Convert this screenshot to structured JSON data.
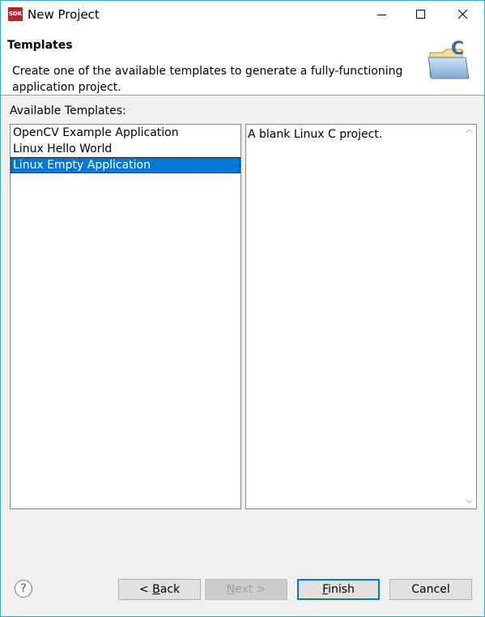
{
  "window": {
    "title": "New Project",
    "app_icon_text": "SDK"
  },
  "header": {
    "title": "Templates",
    "description": "Create one of the available templates to generate a fully-functioning application project."
  },
  "templates": {
    "label": "Available Templates:",
    "items": [
      {
        "label": "OpenCV Example Application",
        "selected": false
      },
      {
        "label": "Linux Hello World",
        "selected": false
      },
      {
        "label": "Linux Empty Application",
        "selected": true
      }
    ],
    "description": "A blank Linux C project."
  },
  "footer": {
    "help_glyph": "?",
    "back": {
      "mnemonic": "B",
      "prefix": "< ",
      "rest": "ack"
    },
    "next": {
      "mnemonic": "N",
      "rest": "ext >"
    },
    "finish": {
      "mnemonic": "F",
      "rest": "inish"
    },
    "cancel": "Cancel"
  },
  "colors": {
    "selection": "#0078d7",
    "window_border": "#36a9cf",
    "app_icon": "#c0202a"
  }
}
